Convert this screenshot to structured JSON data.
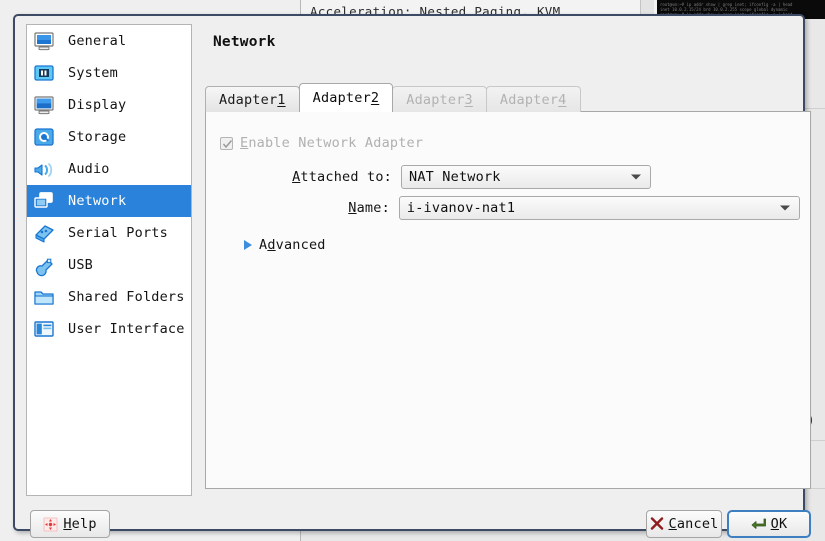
{
  "background": {
    "acceleration_text": "Acceleration: Nested Paging, KVM",
    "trailing_paren": ")",
    "terminal_lines": [
      "root@vm:~# ip addr show | grep inet; ifconfig -a | head",
      "inet 10.0.2.15/24 brd 10.0.2.255 scope global dynamic"
    ]
  },
  "dialog": {
    "title": "Network",
    "sidebar": {
      "items": [
        {
          "label": "General",
          "icon": "monitor-general-icon",
          "selected": false
        },
        {
          "label": "System",
          "icon": "motherboard-system-icon",
          "selected": false
        },
        {
          "label": "Display",
          "icon": "monitor-display-icon",
          "selected": false
        },
        {
          "label": "Storage",
          "icon": "harddisk-storage-icon",
          "selected": false
        },
        {
          "label": "Audio",
          "icon": "speaker-audio-icon",
          "selected": false
        },
        {
          "label": "Network",
          "icon": "network-cards-icon",
          "selected": true
        },
        {
          "label": "Serial Ports",
          "icon": "serial-port-icon",
          "selected": false
        },
        {
          "label": "USB",
          "icon": "usb-plug-icon",
          "selected": false
        },
        {
          "label": "Shared Folders",
          "icon": "folder-shared-icon",
          "selected": false
        },
        {
          "label": "User Interface",
          "icon": "window-layout-icon",
          "selected": false
        }
      ]
    },
    "tabs": [
      {
        "label": "Adapter ",
        "mnemonic": "1",
        "state": "inactive"
      },
      {
        "label": "Adapter ",
        "mnemonic": "2",
        "state": "active"
      },
      {
        "label": "Adapter ",
        "mnemonic": "3",
        "state": "disabled"
      },
      {
        "label": "Adapter ",
        "mnemonic": "4",
        "state": "disabled"
      }
    ],
    "form": {
      "enable_adapter": {
        "label_pre": "",
        "mnemonic": "E",
        "label_post": "nable Network Adapter",
        "checked": true,
        "enabled": false
      },
      "attached_to": {
        "label_pre": "",
        "mnemonic": "A",
        "label_post": "ttached to:",
        "value": "NAT Network"
      },
      "name": {
        "label_pre": "",
        "mnemonic": "N",
        "label_post": "ame:",
        "value": "i-ivanov-nat1"
      },
      "advanced": {
        "label_pre": "A",
        "mnemonic": "d",
        "label_post": "vanced",
        "expanded": false
      }
    },
    "buttons": {
      "help": {
        "label_pre": "",
        "mnemonic": "H",
        "label_post": "elp",
        "icon": "help-arrows-icon"
      },
      "cancel": {
        "label_pre": "",
        "mnemonic": "C",
        "label_post": "ancel",
        "icon": "cross-icon"
      },
      "ok": {
        "label_pre": "",
        "mnemonic": "O",
        "label_post": "K",
        "icon": "enter-arrow-icon",
        "focused": true
      }
    }
  },
  "colors": {
    "accent": "#2a82da",
    "dialog_border": "#3c4a63",
    "focus_ring": "#3d7fc1",
    "disabled_text": "#b0b0b0",
    "advanced_triangle": "#3d8fdd"
  }
}
